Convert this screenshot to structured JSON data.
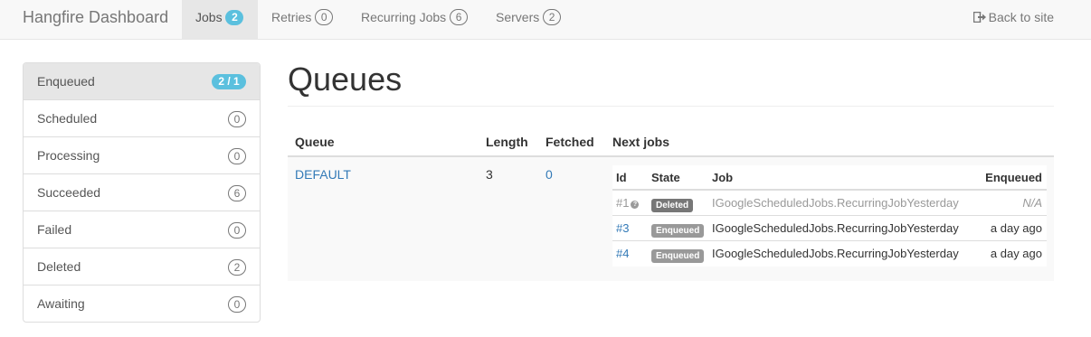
{
  "navbar": {
    "brand": "Hangfire Dashboard",
    "items": [
      {
        "label": "Jobs",
        "badge": "2",
        "active": true
      },
      {
        "label": "Retries",
        "badge": "0"
      },
      {
        "label": "Recurring Jobs",
        "badge": "6"
      },
      {
        "label": "Servers",
        "badge": "2"
      }
    ],
    "back_label": "Back to site"
  },
  "sidebar": {
    "items": [
      {
        "label": "Enqueued",
        "badge": "2 / 1",
        "active": true
      },
      {
        "label": "Scheduled",
        "badge": "0"
      },
      {
        "label": "Processing",
        "badge": "0"
      },
      {
        "label": "Succeeded",
        "badge": "6"
      },
      {
        "label": "Failed",
        "badge": "0"
      },
      {
        "label": "Deleted",
        "badge": "2"
      },
      {
        "label": "Awaiting",
        "badge": "0"
      }
    ]
  },
  "main": {
    "title": "Queues",
    "table": {
      "headers": {
        "queue": "Queue",
        "length": "Length",
        "fetched": "Fetched",
        "next_jobs": "Next jobs"
      },
      "row": {
        "queue": "DEFAULT",
        "length": "3",
        "fetched": "0"
      },
      "jobs": {
        "headers": {
          "id": "Id",
          "state": "State",
          "job": "Job",
          "enqueued": "Enqueued"
        },
        "rows": [
          {
            "id": "#1",
            "state": "Deleted",
            "job": "IGoogleScheduledJobs.RecurringJobYesterday",
            "enqueued": "N/A"
          },
          {
            "id": "#3",
            "state": "Enqueued",
            "job": "IGoogleScheduledJobs.RecurringJobYesterday",
            "enqueued": "a day ago"
          },
          {
            "id": "#4",
            "state": "Enqueued",
            "job": "IGoogleScheduledJobs.RecurringJobYesterday",
            "enqueued": "a day ago"
          }
        ]
      }
    }
  },
  "colors": {
    "accent": "#337ab7",
    "badge_info": "#5bc0de",
    "label_deleted": "#777777",
    "label_enqueued": "#999999"
  },
  "icons": {
    "back": "sign-out-icon",
    "deleted_hint": "question-circle-icon"
  }
}
